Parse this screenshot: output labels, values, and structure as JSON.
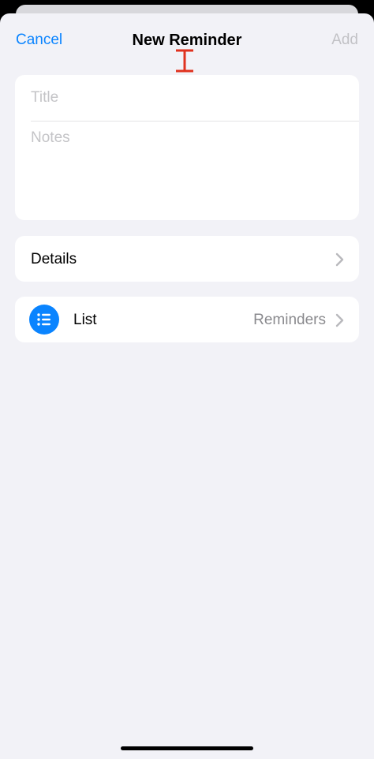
{
  "nav": {
    "cancel_label": "Cancel",
    "title": "New Reminder",
    "add_label": "Add"
  },
  "form": {
    "title_placeholder": "Title",
    "notes_placeholder": "Notes"
  },
  "details": {
    "label": "Details",
    "chevron_icon": "chevron-right-icon"
  },
  "list": {
    "label": "List",
    "value": "Reminders",
    "icon": "list-bullet-icon",
    "icon_color": "#0a84ff"
  },
  "colors": {
    "accent": "#0a84ff",
    "disabled": "#c2c2c6",
    "cursor": "#e0321f"
  }
}
